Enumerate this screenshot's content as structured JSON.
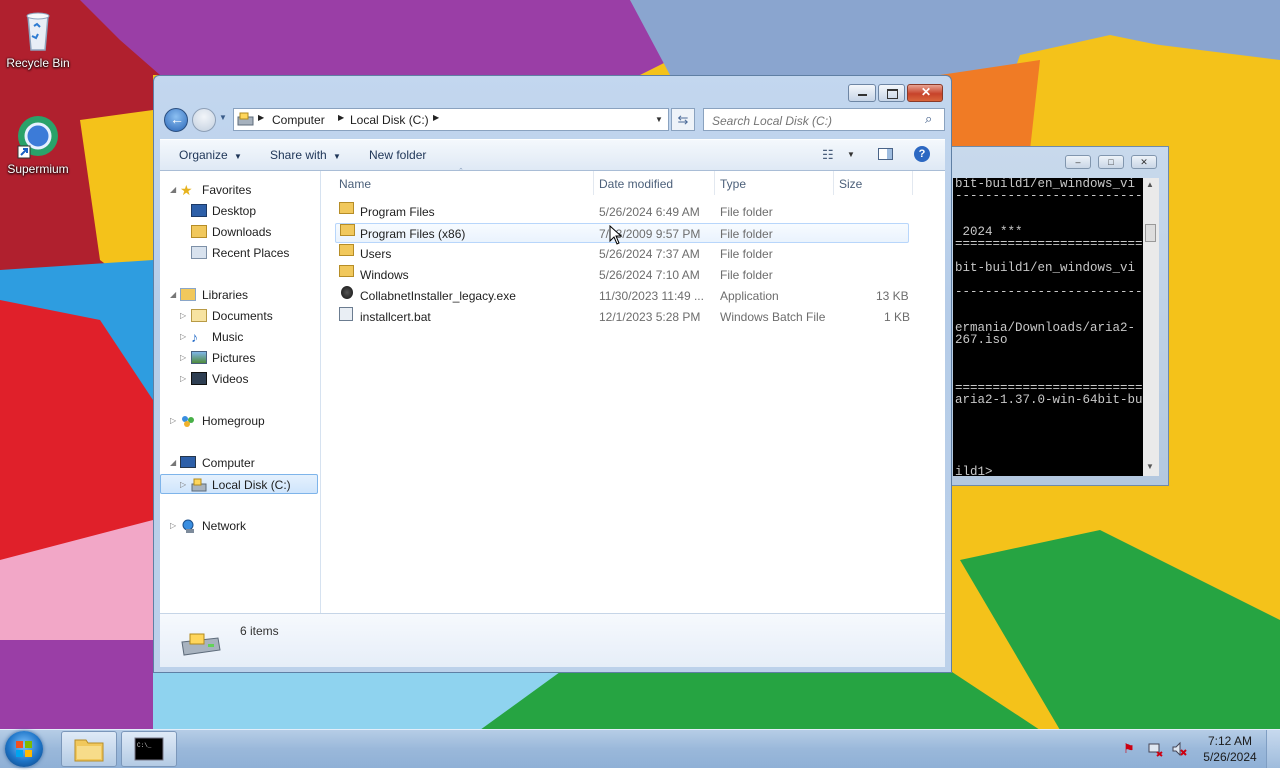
{
  "desktop": {
    "icons": [
      {
        "label": "Recycle Bin"
      },
      {
        "label": "Supermium"
      }
    ]
  },
  "console": {
    "lines": [
      "bit-build1/en_windows_vi",
      "-------------------------",
      "",
      "",
      " 2024 ***",
      "=========================",
      "",
      "bit-build1/en_windows_vi",
      "",
      "-------------------------",
      "",
      "",
      "ermania/Downloads/aria2-",
      "267.iso",
      "",
      "",
      "",
      "=========================",
      "aria2-1.37.0-win-64bit-bu",
      "",
      "",
      "",
      "",
      "",
      "ild1>"
    ]
  },
  "explorer": {
    "breadcrumb": [
      "Computer",
      "Local Disk (C:)"
    ],
    "search_placeholder": "Search Local Disk (C:)",
    "toolbar": {
      "organize": "Organize",
      "share_with": "Share with",
      "new_folder": "New folder"
    },
    "nav": {
      "favorites": "Favorites",
      "desktop": "Desktop",
      "downloads": "Downloads",
      "recent_places": "Recent Places",
      "libraries": "Libraries",
      "documents": "Documents",
      "music": "Music",
      "pictures": "Pictures",
      "videos": "Videos",
      "homegroup": "Homegroup",
      "computer": "Computer",
      "local_disk": "Local Disk (C:)",
      "network": "Network"
    },
    "columns": {
      "name": "Name",
      "date": "Date modified",
      "type": "Type",
      "size": "Size"
    },
    "files": [
      {
        "name": "Program Files",
        "date": "5/26/2024 6:49 AM",
        "type": "File folder",
        "size": ""
      },
      {
        "name": "Program Files (x86)",
        "date": "7/13/2009 9:57 PM",
        "type": "File folder",
        "size": ""
      },
      {
        "name": "Users",
        "date": "5/26/2024 7:37 AM",
        "type": "File folder",
        "size": ""
      },
      {
        "name": "Windows",
        "date": "5/26/2024 7:10 AM",
        "type": "File folder",
        "size": ""
      },
      {
        "name": "CollabnetInstaller_legacy.exe",
        "date": "11/30/2023 11:49 ...",
        "type": "Application",
        "size": "13 KB"
      },
      {
        "name": "installcert.bat",
        "date": "12/1/2023 5:28 PM",
        "type": "Windows Batch File",
        "size": "1 KB"
      }
    ],
    "status": "6 items"
  },
  "taskbar": {
    "time": "7:12 AM",
    "date": "5/26/2024"
  }
}
